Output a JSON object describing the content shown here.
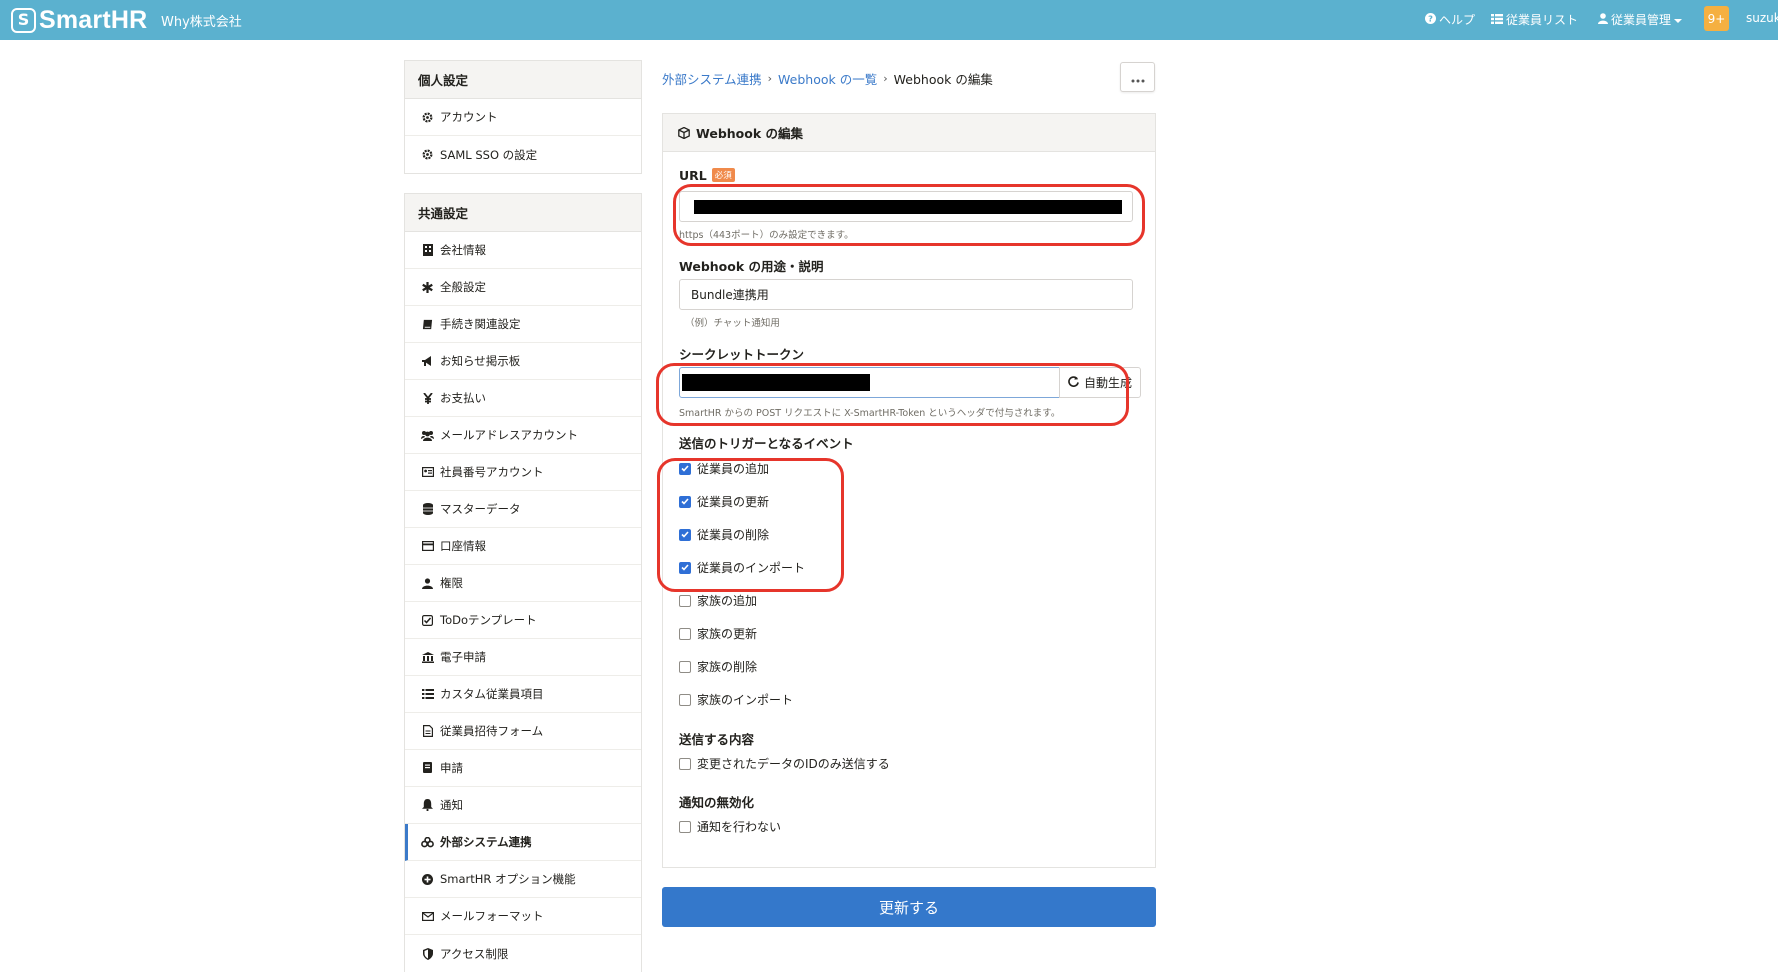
{
  "header": {
    "logo_mark": "S",
    "logo_text": "SmartHR",
    "company": "Why株式会社",
    "help": "ヘルプ",
    "employee_list": "従業員リスト",
    "employee_mgmt": "従業員管理",
    "notifications": "9+",
    "user": "suzuki"
  },
  "sidebar": {
    "personal": {
      "title": "個人設定",
      "items": [
        {
          "label": "アカウント",
          "icon": "gear-icon"
        },
        {
          "label": "SAML SSO の設定",
          "icon": "gear-icon"
        }
      ]
    },
    "common": {
      "title": "共通設定",
      "items": [
        {
          "label": "会社情報",
          "icon": "building-icon"
        },
        {
          "label": "全般設定",
          "icon": "asterisk-icon"
        },
        {
          "label": "手続き関連設定",
          "icon": "book-icon"
        },
        {
          "label": "お知らせ掲示板",
          "icon": "megaphone-icon"
        },
        {
          "label": "お支払い",
          "icon": "yen-icon"
        },
        {
          "label": "メールアドレスアカウント",
          "icon": "users-icon"
        },
        {
          "label": "社員番号アカウント",
          "icon": "id-card-icon"
        },
        {
          "label": "マスターデータ",
          "icon": "database-icon"
        },
        {
          "label": "口座情報",
          "icon": "card-icon"
        },
        {
          "label": "権限",
          "icon": "user-key-icon"
        },
        {
          "label": "ToDoテンプレート",
          "icon": "checkbox-icon"
        },
        {
          "label": "電子申請",
          "icon": "bank-icon"
        },
        {
          "label": "カスタム従業員項目",
          "icon": "list-icon"
        },
        {
          "label": "従業員招待フォーム",
          "icon": "file-icon"
        },
        {
          "label": "申請",
          "icon": "request-icon"
        },
        {
          "label": "通知",
          "icon": "bell-icon"
        },
        {
          "label": "外部システム連携",
          "icon": "link-icon",
          "active": true
        },
        {
          "label": "SmartHR オプション機能",
          "icon": "plus-circle-icon"
        },
        {
          "label": "メールフォーマット",
          "icon": "envelope-icon"
        },
        {
          "label": "アクセス制限",
          "icon": "shield-icon"
        }
      ]
    }
  },
  "breadcrumb": {
    "link1": "外部システム連携",
    "link2": "Webhook の一覧",
    "current": "Webhook の編集"
  },
  "form": {
    "title": "Webhook の編集",
    "url": {
      "label": "URL",
      "required_badge": "必須",
      "help": "https（443ポート）のみ設定できます。"
    },
    "description": {
      "label": "Webhook の用途・説明",
      "value": "Bundle連携用",
      "help": "（例）チャット通知用"
    },
    "secret": {
      "label": "シークレットトークン",
      "regen_button": "自動生成",
      "help": "SmartHR からの POST リクエストに X-SmartHR-Token というヘッダで付与されます。"
    },
    "triggers": {
      "label": "送信のトリガーとなるイベント",
      "items": [
        {
          "label": "従業員の追加",
          "checked": true
        },
        {
          "label": "従業員の更新",
          "checked": true
        },
        {
          "label": "従業員の削除",
          "checked": true
        },
        {
          "label": "従業員のインポート",
          "checked": true
        },
        {
          "label": "家族の追加",
          "checked": false
        },
        {
          "label": "家族の更新",
          "checked": false
        },
        {
          "label": "家族の削除",
          "checked": false
        },
        {
          "label": "家族のインポート",
          "checked": false
        }
      ]
    },
    "content": {
      "label": "送信する内容",
      "option": "変更されたデータのIDのみ送信する",
      "checked": false
    },
    "disable": {
      "label": "通知の無効化",
      "option": "通知を行わない",
      "checked": false
    },
    "submit": "更新する"
  },
  "colors": {
    "header": "#5bb1cf",
    "link": "#3b7ac9",
    "primary_button": "#3478cb",
    "highlight": "#e6352b"
  }
}
